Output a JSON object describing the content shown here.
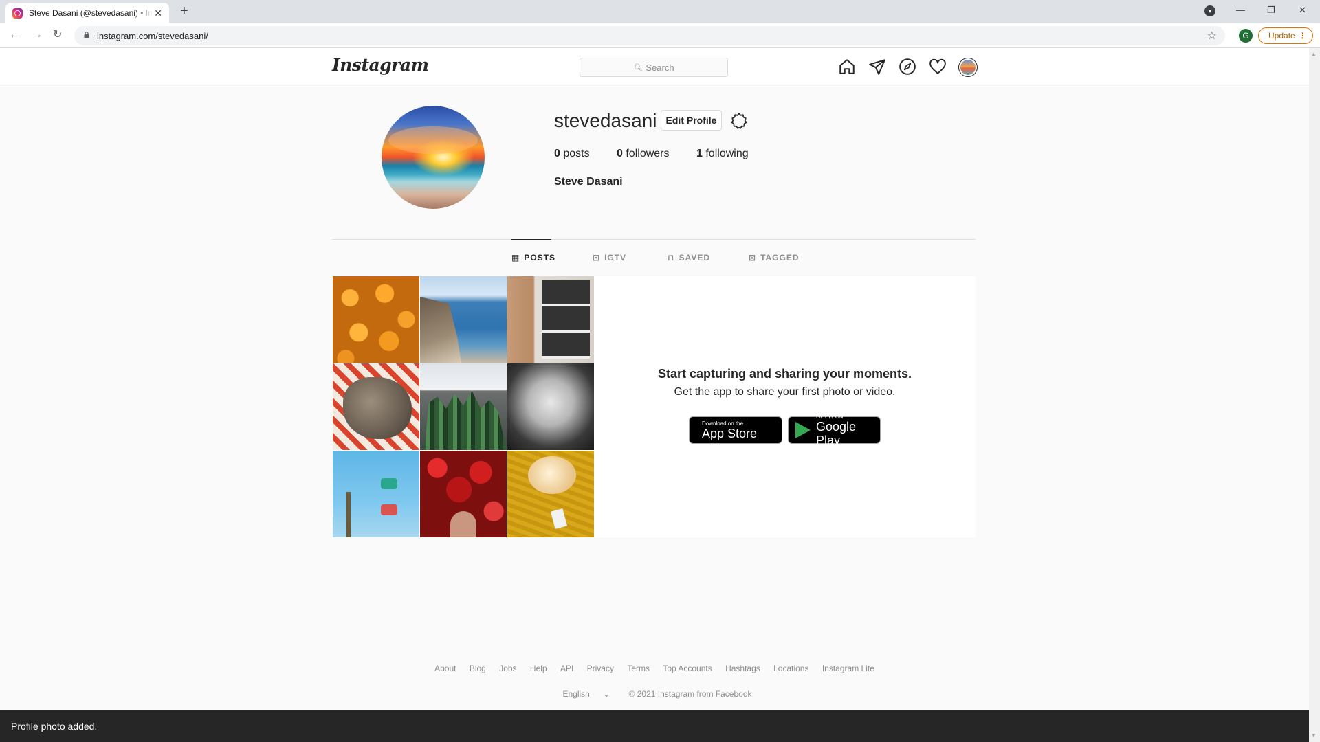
{
  "browser": {
    "tab_title": "Steve Dasani (@stevedasani) • Instagram",
    "url": "instagram.com/stevedasani/",
    "account_initial": "G",
    "update_label": "Update"
  },
  "header": {
    "logo": "Instagram",
    "search_placeholder": "Search"
  },
  "profile": {
    "username": "stevedasani",
    "edit_label": "Edit Profile",
    "posts_count": "0",
    "posts_label": "posts",
    "followers_count": "0",
    "followers_label": "followers",
    "following_count": "1",
    "following_label": "following",
    "full_name": "Steve Dasani"
  },
  "tabs": [
    {
      "label": "POSTS",
      "icon": "grid-icon",
      "active": true
    },
    {
      "label": "IGTV",
      "icon": "igtv-icon",
      "active": false
    },
    {
      "label": "SAVED",
      "icon": "bookmark-icon",
      "active": false
    },
    {
      "label": "TAGGED",
      "icon": "tag-icon",
      "active": false
    }
  ],
  "empty_state": {
    "title": "Start capturing and sharing your moments.",
    "subtitle": "Get the app to share your first photo or video.",
    "app_store_small": "Download on the",
    "app_store_big": "App Store",
    "google_play_small": "GET IT ON",
    "google_play_big": "Google Play"
  },
  "footer": {
    "links": [
      "About",
      "Blog",
      "Jobs",
      "Help",
      "API",
      "Privacy",
      "Terms",
      "Top Accounts",
      "Hashtags",
      "Locations",
      "Instagram Lite"
    ],
    "language": "English",
    "copyright": "© 2021 Instagram from Facebook"
  },
  "toast": "Profile photo added."
}
